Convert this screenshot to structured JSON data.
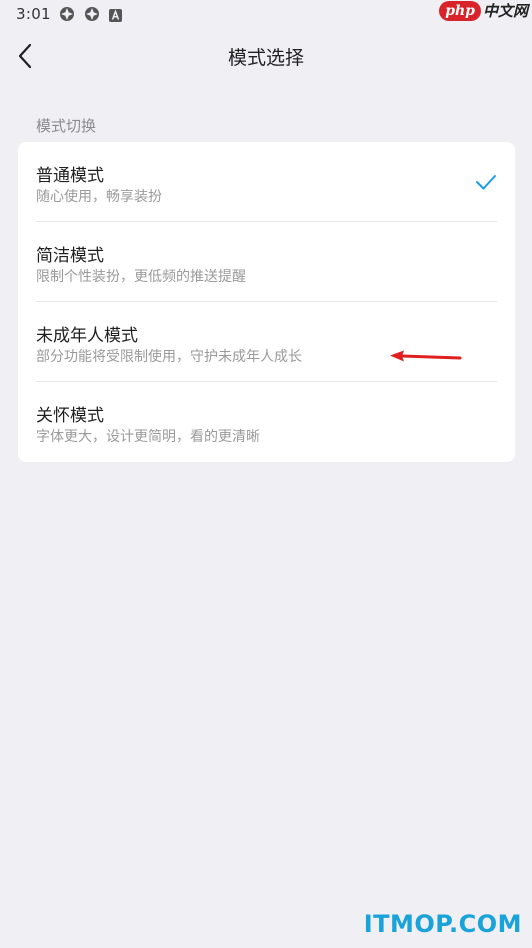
{
  "status_bar": {
    "time": "3:01",
    "icons": [
      "app-notification-icon",
      "app-notification-icon",
      "a-badge-icon"
    ]
  },
  "watermark_top": {
    "brand": "php",
    "suffix": "中文网"
  },
  "nav": {
    "title": "模式选择",
    "back_icon": "chevron-left-icon"
  },
  "section": {
    "label": "模式切换"
  },
  "modes": [
    {
      "title": "普通模式",
      "desc": "随心使用，畅享装扮",
      "selected": true
    },
    {
      "title": "简洁模式",
      "desc": "限制个性装扮，更低频的推送提醒",
      "selected": false
    },
    {
      "title": "未成年人模式",
      "desc": "部分功能将受限制使用，守护未成年人成长",
      "selected": false
    },
    {
      "title": "关怀模式",
      "desc": "字体更大，设计更简明，看的更清晰",
      "selected": false
    }
  ],
  "colors": {
    "accent": "#1a9bf0",
    "arrow": "#e02020",
    "background": "#f0eff4",
    "card": "#ffffff"
  },
  "watermark_bottom": {
    "text": "ITMOP.COM"
  }
}
